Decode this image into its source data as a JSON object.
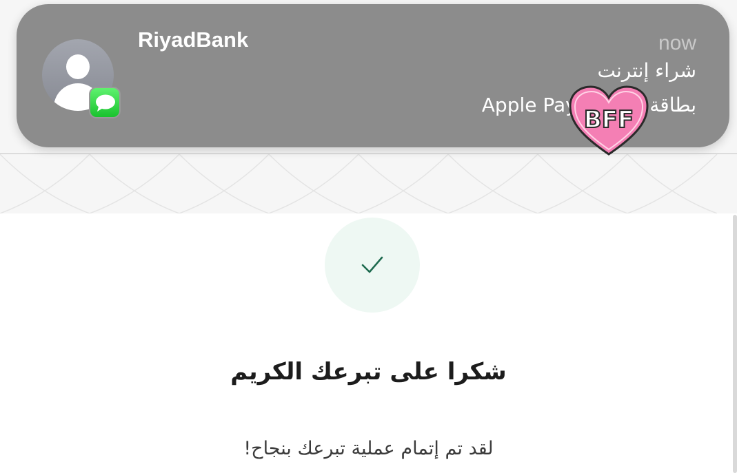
{
  "notification": {
    "app_name": "RiyadBank",
    "time": "now",
    "title": "شراء إنترنت",
    "body": "بطاقة ;مدى ...Apple Pay",
    "avatar_icon": "person-icon",
    "badge_icon": "messages-icon"
  },
  "sticker": {
    "text": "BFF",
    "color": "#f47fb4"
  },
  "page": {
    "success_icon": "checkmark-icon",
    "accent_color": "#1e6b4f",
    "title": "شكرا على تبرعك الكريم",
    "message": "لقد تم إتمام عملية تبرعك بنجاح!"
  }
}
